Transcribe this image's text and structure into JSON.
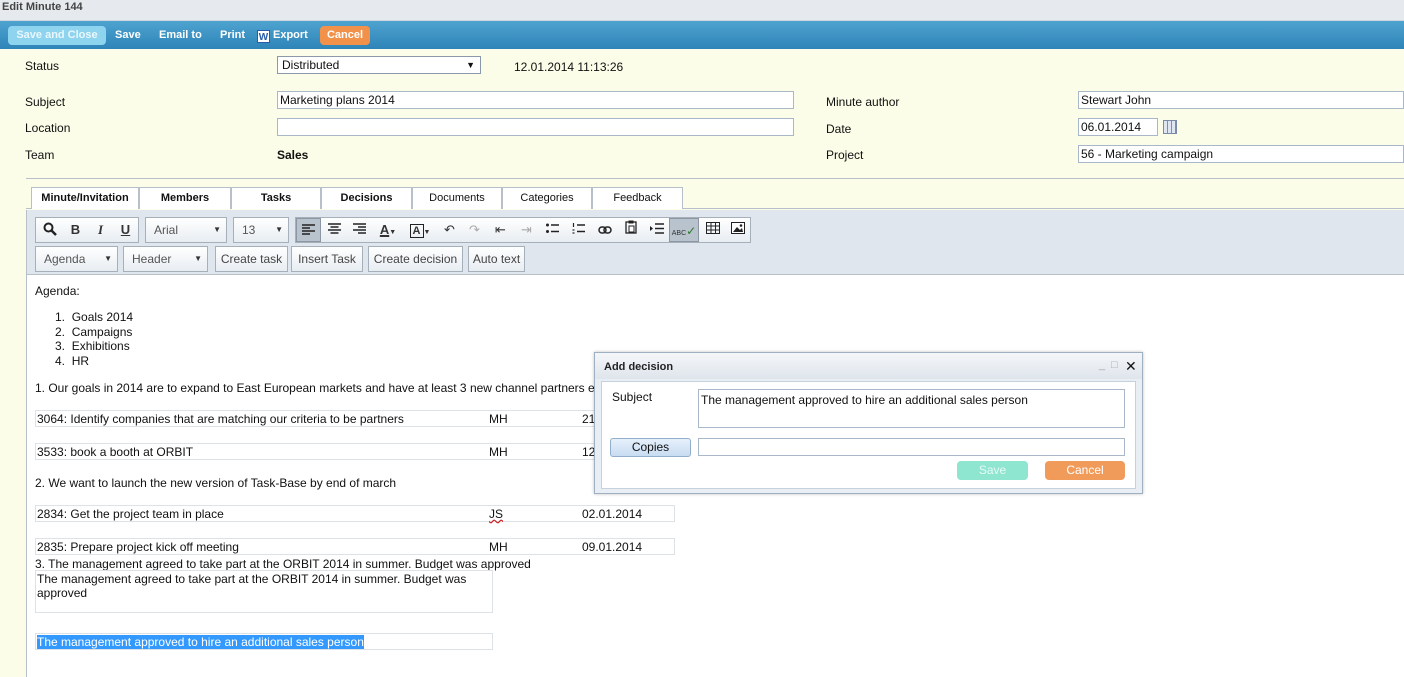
{
  "window": {
    "title": "Edit Minute 144"
  },
  "actions": {
    "save_close": "Save and Close",
    "save": "Save",
    "email": "Email to",
    "print": "Print",
    "export": "Export",
    "export_icon_glyph": "W",
    "cancel": "Cancel"
  },
  "form": {
    "status_label": "Status",
    "status_value": "Distributed",
    "status_timestamp": "12.01.2014 11:13:26",
    "subject_label": "Subject",
    "subject_value": "Marketing plans 2014",
    "location_label": "Location",
    "location_value": "",
    "team_label": "Team",
    "team_value": "Sales",
    "author_label": "Minute author",
    "author_value": "Stewart John",
    "date_label": "Date",
    "date_value": "06.01.2014",
    "project_label": "Project",
    "project_value": "56 - Marketing campaign"
  },
  "tabs": [
    {
      "label": "Minute/Invitation"
    },
    {
      "label": "Members"
    },
    {
      "label": "Tasks"
    },
    {
      "label": "Decisions"
    },
    {
      "label": "Documents"
    },
    {
      "label": "Categories"
    },
    {
      "label": "Feedback"
    }
  ],
  "toolbar": {
    "font": "Arial",
    "size": "13",
    "agenda": "Agenda",
    "header": "Header",
    "create_task": "Create task",
    "insert_task": "Insert Task",
    "create_decision": "Create decision",
    "auto_text": "Auto text",
    "bold_glyph": "B",
    "italic_glyph": "I",
    "underline_glyph": "U",
    "font_color_glyph": "A",
    "bg_color_glyph": "A",
    "spell_glyph": "ABC",
    "icons": [
      "search-icon",
      "bold-icon",
      "italic-icon",
      "underline-icon",
      "align-left-icon",
      "align-center-icon",
      "align-right-icon",
      "font-color-icon",
      "background-color-icon",
      "undo-icon",
      "redo-icon",
      "outdent-icon",
      "indent-icon",
      "bullet-list-icon",
      "numbered-list-icon",
      "link-icon",
      "paste-icon",
      "insert-row-icon",
      "spellcheck-icon",
      "table-icon",
      "image-icon"
    ]
  },
  "content": {
    "agenda_heading": "Agenda:",
    "agenda_items": [
      {
        "num": "1.",
        "text": "Goals 2014"
      },
      {
        "num": "2.",
        "text": "Campaigns"
      },
      {
        "num": "3.",
        "text": "Exhibitions"
      },
      {
        "num": "4.",
        "text": "HR"
      }
    ],
    "para1": "1.  Our goals in 2014 are to expand to East European markets and have at least 3 new channel partners e",
    "tasks1": [
      {
        "id_text": "3064: Identify companies that are matching our criteria to be partners",
        "owner": "MH",
        "date": "21"
      },
      {
        "id_text": "3533: book a booth at ORBIT",
        "owner": "MH",
        "date": "12"
      }
    ],
    "para2": "2.  We want to launch the new version of Task-Base by end of march",
    "tasks2": [
      {
        "id_text": "2834: Get the project team in place",
        "owner": "JS",
        "date": "02.01.2014"
      },
      {
        "id_text": "2835: Prepare project kick off meeting",
        "owner": "MH",
        "date": "09.01.2014"
      }
    ],
    "para3": "3. The management agreed to take part at the ORBIT 2014 in summer. Budget was approved",
    "decision_box_line1": "The management agreed to take part at the ORBIT 2014 in summer. Budget was",
    "decision_box_line2": "approved",
    "highlighted": "The management approved to hire an additional sales person"
  },
  "dialog": {
    "title": "Add decision",
    "subject_label": "Subject",
    "subject_value": "The management approved to hire an additional sales person",
    "copies_label": "Copies",
    "copies_value": "",
    "save": "Save",
    "cancel": "Cancel"
  },
  "colors": {
    "actionbar": "#3a93c4",
    "form_bg": "#fbfde8",
    "cancel": "#f2914a",
    "save_close": "#8fd4ef",
    "highlight": "#3399ff"
  }
}
